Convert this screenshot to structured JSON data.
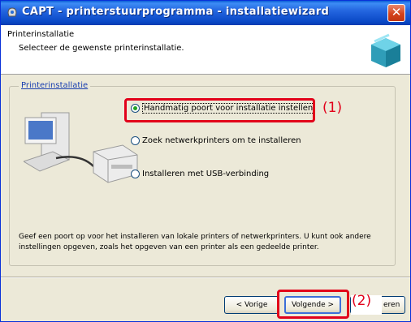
{
  "window": {
    "title": "CAPT - printerstuurprogramma - installatiewizard",
    "close_glyph": "✕"
  },
  "header": {
    "title": "Printerinstallatie",
    "subtitle": "Selecteer de gewenste printerinstallatie."
  },
  "group": {
    "legend": "Printerinstallatie",
    "options": [
      {
        "label": "Handmatig poort voor installatie instellen",
        "checked": true
      },
      {
        "label": "Zoek netwerkprinters om te installeren",
        "checked": false
      },
      {
        "label": "Installeren met USB-verbinding",
        "checked": false
      }
    ],
    "description": "Geef een poort op voor het installeren van lokale printers of netwerkprinters. U kunt ook andere instellingen opgeven, zoals het opgeven van een printer als een gedeelde printer."
  },
  "callouts": {
    "one": "(1)",
    "two": "(2)"
  },
  "buttons": {
    "prev": "< Vorige",
    "next": "Volgende >",
    "cancel_partial": "eren"
  },
  "colors": {
    "titlebar": "#2466e0",
    "callout": "#e2001a",
    "dialog_bg": "#ece9d8"
  }
}
